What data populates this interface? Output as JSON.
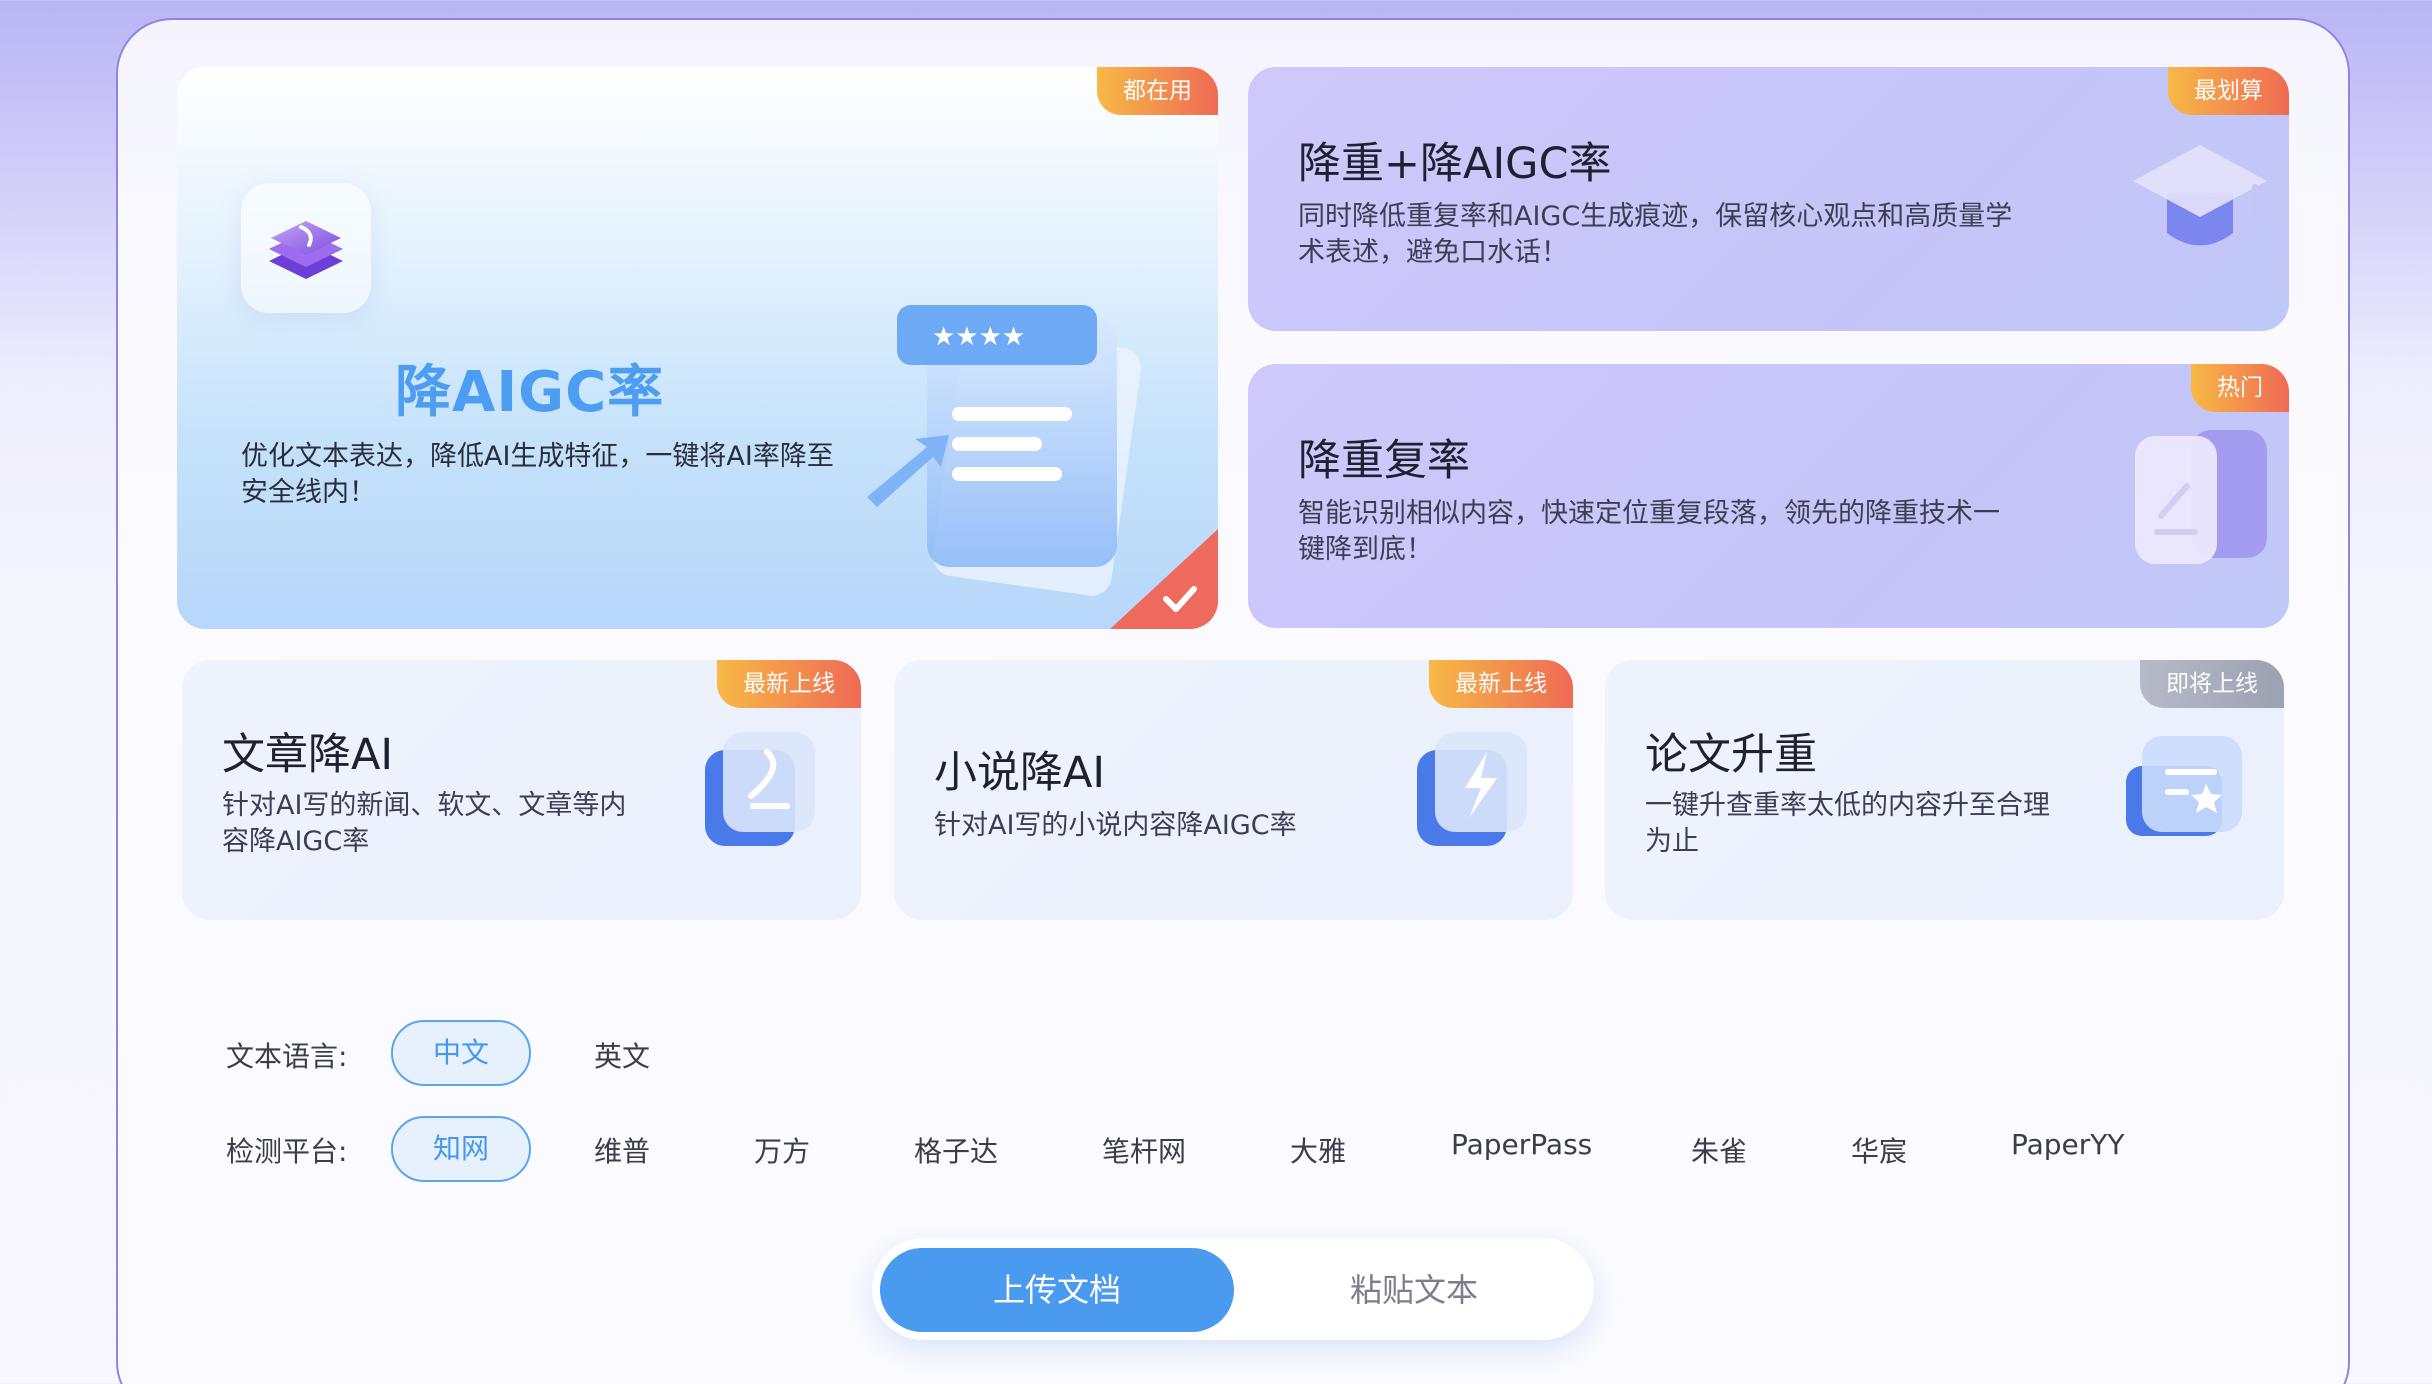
{
  "cards": {
    "main": {
      "badge": "都在用",
      "title": "降AIGC率",
      "desc": "优化文本表达，降低AI生成特征，一键将AI率降至安全线内！"
    },
    "combined": {
      "badge": "最划算",
      "title": "降重+降AIGC率",
      "desc": "同时降低重复率和AIGC生成痕迹，保留核心观点和高质量学术表述，避免口水话！"
    },
    "dedup": {
      "badge": "热门",
      "title": "降重复率",
      "desc": "智能识别相似内容，快速定位重复段落，领先的降重技术一键降到底！"
    },
    "article": {
      "badge": "最新上线",
      "title": "文章降AI",
      "desc": "针对AI写的新闻、软文、文章等内容降AIGC率"
    },
    "novel": {
      "badge": "最新上线",
      "title": "小说降AI",
      "desc": "针对AI写的小说内容降AIGC率"
    },
    "thesis": {
      "badge": "即将上线",
      "title": "论文升重",
      "desc": "一键升查重率太低的内容升至合理为止"
    }
  },
  "language": {
    "label": "文本语言:",
    "options": [
      "中文",
      "英文"
    ],
    "selected": "中文"
  },
  "platform": {
    "label": "检测平台:",
    "options": [
      "知网",
      "维普",
      "万方",
      "格子达",
      "笔杆网",
      "大雅",
      "PaperPass",
      "朱雀",
      "华宸",
      "PaperYY"
    ],
    "selected": "知网"
  },
  "input_mode": {
    "upload": "上传文档",
    "paste": "粘贴文本",
    "selected": "上传文档"
  },
  "colors": {
    "accent": "#4a9bf0",
    "badge_warm": "#ef6a55",
    "badge_coming": "#9ca1b3"
  },
  "icons": {
    "main_app": "layers-icon",
    "main_illustration": "document-stars-icon",
    "selected": "check-icon",
    "combined": "graduation-cap-icon",
    "dedup": "edit-cards-icon",
    "article": "pen-card-icon",
    "novel": "lightning-card-icon",
    "thesis": "star-card-icon"
  }
}
